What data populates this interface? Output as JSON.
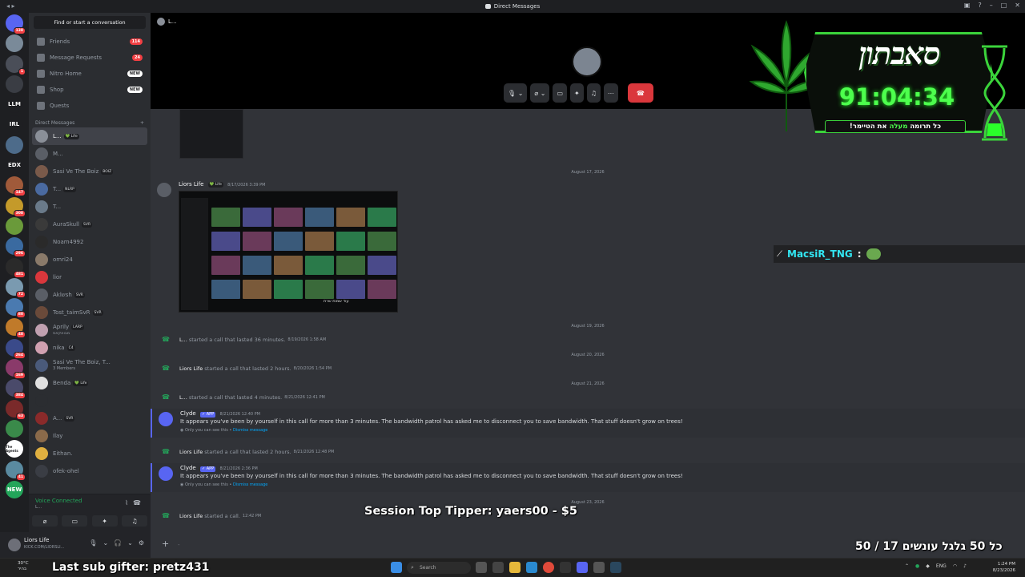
{
  "window": {
    "title": "Direct Messages"
  },
  "servers": [
    {
      "badge": "138",
      "color": "#5865f2",
      "label": ""
    },
    {
      "badge": "",
      "color": "#7a8a99",
      "label": ""
    },
    {
      "badge": "1",
      "color": "#4a4e58",
      "label": ""
    },
    {
      "badge": "",
      "color": "#3a3d44",
      "label": ""
    },
    {
      "badge": "",
      "color": "#1e1f22",
      "label": "LLM"
    },
    {
      "badge": "",
      "color": "#1e1f22",
      "label": "IRL"
    },
    {
      "badge": "",
      "color": "#4d6b8a",
      "label": ""
    },
    {
      "badge": "",
      "color": "#1e1f22",
      "label": "EDX"
    },
    {
      "badge": "147",
      "color": "#a05a3a",
      "label": ""
    },
    {
      "badge": "308",
      "color": "#c49a2a",
      "label": ""
    },
    {
      "badge": "",
      "color": "#6a9a3a",
      "label": ""
    },
    {
      "badge": "296",
      "color": "#3a6aa0",
      "label": ""
    },
    {
      "badge": "481",
      "color": "#2a2a2a",
      "label": ""
    },
    {
      "badge": "72",
      "color": "#7a9ab0",
      "label": ""
    },
    {
      "badge": "80",
      "color": "#4a7ab0",
      "label": ""
    },
    {
      "badge": "48",
      "color": "#c07a2a",
      "label": ""
    },
    {
      "badge": "264",
      "color": "#3a4a8a",
      "label": ""
    },
    {
      "badge": "169",
      "color": "#8a3a6a",
      "label": ""
    },
    {
      "badge": "384",
      "color": "#4a4a6a",
      "label": ""
    },
    {
      "badge": "63",
      "color": "#7a2a2a",
      "label": ""
    },
    {
      "badge": "",
      "color": "#3a8a4a",
      "label": ""
    },
    {
      "badge": "",
      "color": "#ffffff",
      "label": "The Agents"
    },
    {
      "badge": "41",
      "color": "#5a8aa0",
      "label": ""
    },
    {
      "badge": "",
      "color": "#23a55a",
      "label": "NEW"
    }
  ],
  "sidebar": {
    "find_label": "Find or start a conversation",
    "nav": [
      {
        "label": "Friends",
        "pill": "114",
        "pill_type": "red"
      },
      {
        "label": "Message Requests",
        "pill": "24",
        "pill_type": "red"
      },
      {
        "label": "Nitro Home",
        "pill": "NEW",
        "pill_type": "white"
      },
      {
        "label": "Shop",
        "pill": "NEW",
        "pill_type": "white"
      },
      {
        "label": "Quests",
        "pill": "",
        "pill_type": ""
      }
    ],
    "dm_header": "Direct Messages",
    "dm_add": "+",
    "dms": [
      {
        "name": "L...",
        "tag": "💚 Life",
        "sub": "",
        "color": "#8a8f98",
        "selected": true
      },
      {
        "name": "M...",
        "tag": "",
        "sub": "",
        "color": "#5a5e66",
        "selected": false
      },
      {
        "name": "Sasi Ve The Boiz",
        "tag": "BOIZ",
        "sub": "",
        "color": "#7a5a4a",
        "selected": false
      },
      {
        "name": "T...",
        "tag": "NLRP",
        "sub": "",
        "color": "#4a6aa0",
        "selected": false
      },
      {
        "name": "T...",
        "tag": "",
        "sub": "",
        "color": "#6a7a8a",
        "selected": false
      },
      {
        "name": "AuraSkull",
        "tag": "SVR",
        "sub": "",
        "color": "#3a3a3a",
        "selected": false
      },
      {
        "name": "Noam4992",
        "tag": "",
        "sub": "",
        "color": "#2a2a2a",
        "selected": false
      },
      {
        "name": "omri24",
        "tag": "",
        "sub": "",
        "color": "#8a7a6a",
        "selected": false
      },
      {
        "name": "lior",
        "tag": "",
        "sub": "",
        "color": "#da373c",
        "selected": false
      },
      {
        "name": "Aklשsh",
        "tag": "SVR",
        "sub": "",
        "color": "#5a5e66",
        "selected": false
      },
      {
        "name": "Tost_taimSvR",
        "tag": "SVR",
        "sub": "",
        "color": "#6a4a3a",
        "selected": false
      },
      {
        "name": "Aprily",
        "tag": "LARP",
        "sub": "מבואקאס",
        "color": "#c0a0b0",
        "selected": false
      },
      {
        "name": "nika",
        "tag": "C4",
        "sub": "",
        "color": "#d0a0b0",
        "selected": false
      },
      {
        "name": "Sasi Ve The Boiz, T...",
        "tag": "",
        "sub": "3 Members",
        "color": "#4a5a7a",
        "selected": false
      },
      {
        "name": "Benda",
        "tag": "💚 Life",
        "sub": "",
        "color": "#e0e0e0",
        "selected": false
      },
      {
        "name": "",
        "tag": "",
        "sub": "",
        "color": "#2b2d31",
        "selected": false
      },
      {
        "name": "A...",
        "tag": "SVR",
        "sub": "",
        "color": "#8a2a2a",
        "selected": false
      },
      {
        "name": "Ilay",
        "tag": "",
        "sub": "",
        "color": "#8a6a4a",
        "selected": false
      },
      {
        "name": "Eithan.",
        "tag": "",
        "sub": "",
        "color": "#e0b040",
        "selected": false
      },
      {
        "name": "ofek-ohel",
        "tag": "",
        "sub": "",
        "color": "#3a3d44",
        "selected": false
      }
    ]
  },
  "voice": {
    "status": "Voice Connected",
    "channel": "L..."
  },
  "user": {
    "name": "Liors Life",
    "status": "KICK.COM/LIORSLI..."
  },
  "call": {
    "header_name": "L..."
  },
  "messages": {
    "dates": [
      "August 17, 2026",
      "August 19, 2026",
      "August 20, 2026",
      "August 21, 2026",
      "August 23, 2026"
    ],
    "image_post": {
      "author": "Liors Life",
      "tag": "💚 Life",
      "timestamp": "8/17/2026 3:39 PM",
      "overlay_text": "עוד שמות שרת"
    },
    "calls": [
      {
        "author": "L...",
        "text": "started a call that lasted 36 minutes.",
        "ts": "8/19/2026 1:58 AM"
      },
      {
        "author": "Liors Life",
        "text": "started a call that lasted 2 hours.",
        "ts": "8/20/2026 1:54 PM"
      },
      {
        "author": "L...",
        "text": "started a call that lasted 4 minutes.",
        "ts": "8/21/2026 12:41 PM"
      },
      {
        "author": "Liors Life",
        "text": "started a call that lasted 2 hours.",
        "ts": "8/21/2026 12:48 PM"
      },
      {
        "author": "Liors Life",
        "text": "started a call.",
        "ts": "12:42 PM"
      }
    ],
    "clyde": [
      {
        "author": "Clyde",
        "app": "✓ APP",
        "ts": "8/21/2026 12:40 PM",
        "body": "It appears you've been by yourself in this call for more than 3 minutes. The bandwidth patrol has asked me to disconnect you to save bandwidth. That stuff doesn't grow on trees!",
        "eph": "Only you can see this •",
        "dismiss": "Dismiss message"
      },
      {
        "author": "Clyde",
        "app": "✓ APP",
        "ts": "8/21/2026 2:36 PM",
        "body": "It appears you've been by yourself in this call for more than 3 minutes. The bandwidth patrol has asked me to disconnect you to save bandwidth. That stuff doesn't grow on trees!",
        "eph": "Only you can see this •",
        "dismiss": "Dismiss message"
      }
    ]
  },
  "composer": {
    "plus": "+",
    "placeholder": "-"
  },
  "overlays": {
    "widget_title": "סאבתון",
    "timer": "91:04:34",
    "widget_sub_before": "כל תרומה ",
    "widget_sub_highlight": "מעלה",
    "widget_sub_after": " את הטיימר!",
    "chat_name": "MacsiR_TNG",
    "chat_colon": ":",
    "top_tipper": "Session Top Tipper: yaers00 - $5",
    "last_sub": "Last sub gifter: pretz431",
    "goal": "50 / 17 כל 50 גלגל עונשים"
  },
  "taskbar": {
    "temp": "30°C",
    "weather": "בהיר",
    "search": "Search",
    "lang": "ENG",
    "time": "1:24 PM",
    "date": "8/23/2026"
  }
}
